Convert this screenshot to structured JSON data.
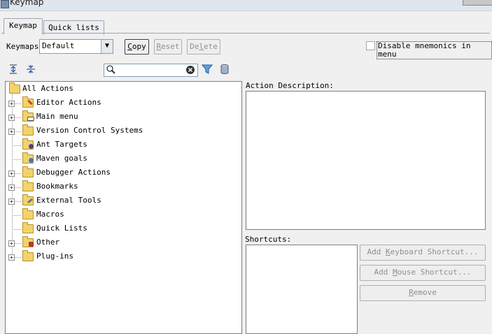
{
  "window": {
    "title": "Keymap"
  },
  "tabs": [
    {
      "label": "Keymap",
      "active": true
    },
    {
      "label": "Quick lists",
      "active": false
    }
  ],
  "toolbar": {
    "keymaps_label": "Keymaps",
    "keymap_value": "Default",
    "copy_label": "Copy",
    "reset_label": "Reset",
    "delete_label": "Delete",
    "disable_mnemonics_label": "Disable mnemonics in menu",
    "disable_mnemonics_checked": false
  },
  "search": {
    "value": ""
  },
  "tree": {
    "root_label": "All Actions",
    "items": [
      {
        "label": "Editor Actions",
        "expandable": true,
        "icon": "editor-folder-icon"
      },
      {
        "label": "Main menu",
        "expandable": true,
        "icon": "menu-folder-icon"
      },
      {
        "label": "Version Control Systems",
        "expandable": true,
        "icon": "folder-icon"
      },
      {
        "label": "Ant Targets",
        "expandable": false,
        "icon": "ant-folder-icon"
      },
      {
        "label": "Maven goals",
        "expandable": false,
        "icon": "maven-folder-icon"
      },
      {
        "label": "Debugger Actions",
        "expandable": true,
        "icon": "folder-icon"
      },
      {
        "label": "Bookmarks",
        "expandable": true,
        "icon": "folder-icon"
      },
      {
        "label": "External Tools",
        "expandable": true,
        "icon": "tools-folder-icon"
      },
      {
        "label": "Macros",
        "expandable": false,
        "icon": "folder-icon"
      },
      {
        "label": "Quick Lists",
        "expandable": false,
        "icon": "folder-icon"
      },
      {
        "label": "Other",
        "expandable": true,
        "icon": "other-folder-icon"
      },
      {
        "label": "Plug-ins",
        "expandable": true,
        "icon": "folder-icon"
      }
    ]
  },
  "description": {
    "label": "Action Description:"
  },
  "shortcuts": {
    "label": "Shortcuts:",
    "add_keyboard_label": "Add Keyboard Shortcut...",
    "add_mouse_label": "Add Mouse Shortcut...",
    "remove_label": "Remove"
  }
}
